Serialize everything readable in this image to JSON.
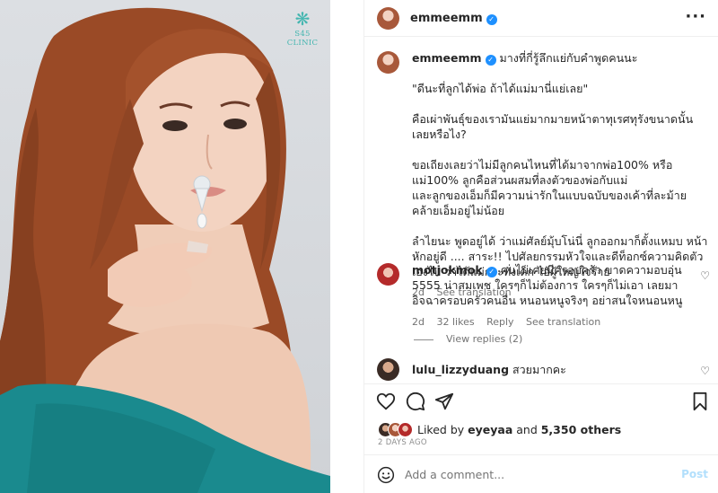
{
  "photo": {
    "clinic_logo_text": "S45 CLINIC",
    "icon": "snowflake-logo-icon"
  },
  "header": {
    "username": "emmeemm",
    "verified": true,
    "more_icon": "more-horizontal-icon"
  },
  "caption": {
    "username": "emmeemm",
    "first_line": "มางที่กี่รู้ลึกแย่กับคำพูดคนนะ",
    "paragraphs": [
      "\"ดีนะที่ลูกได้พ่อ ถ้าได้แม่มานี่แย่เลย\"",
      "คือเผ่าพันธุ์ของเรามันแย่มากมายหน้าตาทุเรศทุรังขนาดนั้นเลยหรือไง?",
      "ขอเถียงเลยว่าไม่มีลูกคนไหนที่ได้มาจากพ่อ100% หรือแม่100% ลูกคือส่วนผสมที่ลงตัวของพ่อกับแม่\nและลูกของเอ็มก็มีความน่ารักในแบบฉบับของเค้าที่ละม้ายคล้ายเอ็มอยู่ไม่น้อย",
      "ลำไยนะ พูดอยู่ได้ ว่าแม่ศัลย์มุ้บโน่นี่ ลูกออกมาก็ตั้งแหมบ หน้าหักอยู่ดี .... สาระ!! ไปศัลยกรรมหัวใจและดีท็อกซ์ความคิดตัวเองไป ว่าได้แม่กระทั่งเด็ก ไอ้ผู้ใหญ่ใจร้าย"
    ],
    "time": "2d",
    "see_translation": "See translation"
  },
  "comments": [
    {
      "username": "motjokmok",
      "verified": true,
      "text": "คนไม่เคยมีครอบครัว ขาดความอบอุ่น 5555 น่าสมเพช ใครๆก็ไม่ต้องการ ใครๆก็ไม่เอา เลยมาอิจฉาครอบครัวคนอื่น หนอนหนูจริงๆ อย่าสนใจหนอนหนู",
      "time": "2d",
      "likes": "32 likes",
      "reply": "Reply",
      "see_translation": "See translation",
      "view_replies": "View replies (2)"
    },
    {
      "username": "lulu_lizzyduang",
      "verified": false,
      "text": "สวยมากคะ"
    }
  ],
  "actions": {
    "like_icon": "heart-icon",
    "comment_icon": "comment-icon",
    "share_icon": "paper-plane-icon",
    "save_icon": "bookmark-icon"
  },
  "likes": {
    "prefix": "Liked by ",
    "user": "eyeyaa",
    "middle": " and ",
    "others": "5,350 others"
  },
  "date": "2 DAYS AGO",
  "add_comment": {
    "placeholder": "Add a comment...",
    "post_label": "Post"
  },
  "colors": {
    "verified": "#1e90ff",
    "muted": "#737373",
    "post_disabled": "#b2dffc",
    "logo_teal": "#45b6b0",
    "dress_teal": "#1a8a8e"
  }
}
